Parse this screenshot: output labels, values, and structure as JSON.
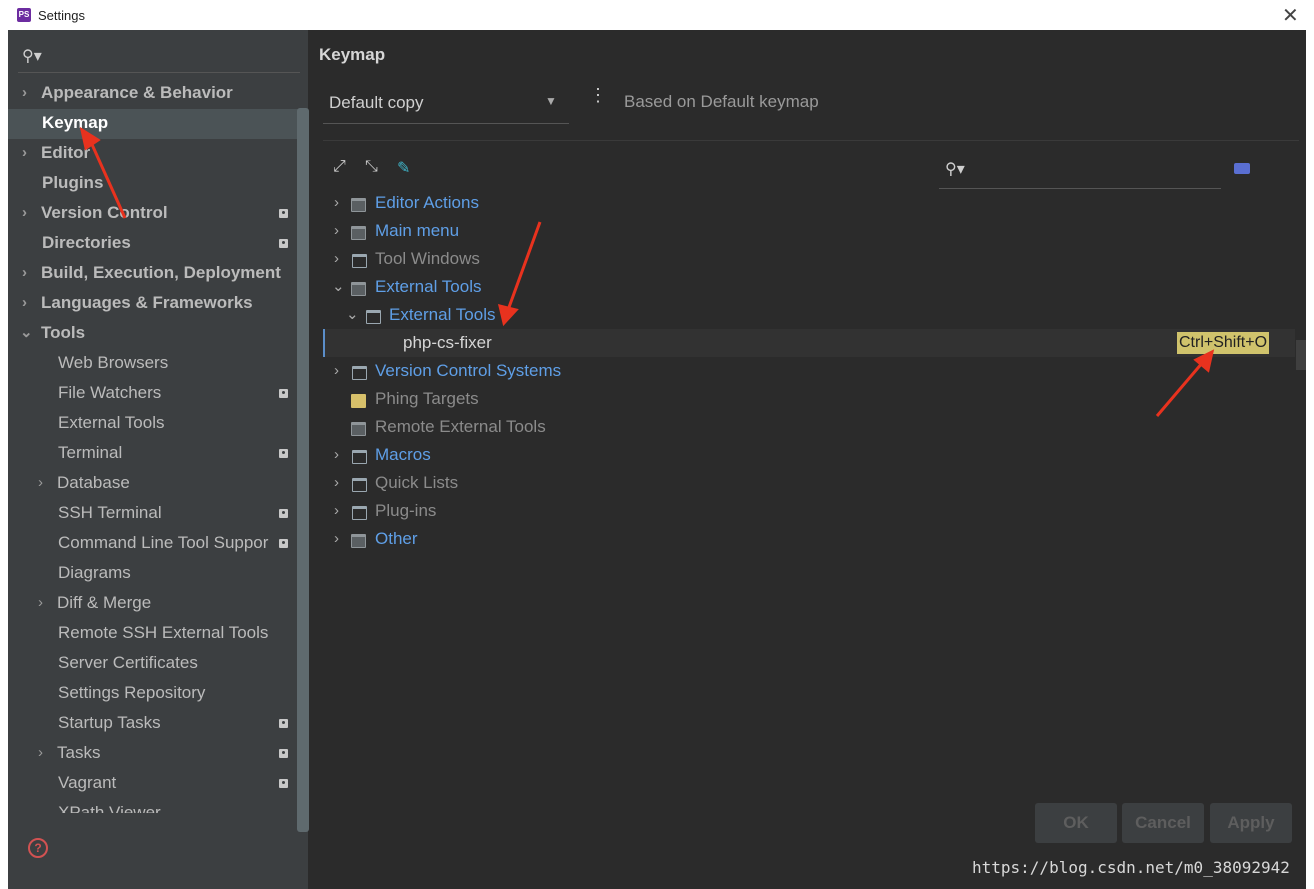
{
  "window": {
    "title": "Settings",
    "app_icon_text": "PS"
  },
  "sidebar": {
    "items": [
      {
        "label": "Appearance & Behavior",
        "bold": true
      },
      {
        "label": "Keymap",
        "bold": true,
        "selected": true
      },
      {
        "label": "Editor",
        "bold": true
      },
      {
        "label": "Plugins",
        "bold": true
      },
      {
        "label": "Version Control",
        "bold": true
      },
      {
        "label": "Directories",
        "bold": true
      },
      {
        "label": "Build, Execution, Deployment",
        "bold": true
      },
      {
        "label": "Languages & Frameworks",
        "bold": true
      },
      {
        "label": "Tools",
        "bold": true
      },
      {
        "label": "Web Browsers"
      },
      {
        "label": "File Watchers"
      },
      {
        "label": "External Tools"
      },
      {
        "label": "Terminal"
      },
      {
        "label": "Database"
      },
      {
        "label": "SSH Terminal"
      },
      {
        "label": "Command Line Tool Suppor"
      },
      {
        "label": "Diagrams"
      },
      {
        "label": "Diff & Merge"
      },
      {
        "label": "Remote SSH External Tools"
      },
      {
        "label": "Server Certificates"
      },
      {
        "label": "Settings Repository"
      },
      {
        "label": "Startup Tasks"
      },
      {
        "label": "Tasks"
      },
      {
        "label": "Vagrant"
      },
      {
        "label": "XPath Viewer"
      }
    ]
  },
  "main": {
    "title": "Keymap",
    "keymap_value": "Default copy",
    "based_on": "Based on Default keymap",
    "tree": [
      {
        "label": "Editor Actions"
      },
      {
        "label": "Main menu"
      },
      {
        "label": "Tool Windows"
      },
      {
        "label": "External Tools"
      },
      {
        "label": "External Tools"
      },
      {
        "label": "php-cs-fixer",
        "shortcut": "Ctrl+Shift+O"
      },
      {
        "label": "Version Control Systems"
      },
      {
        "label": "Phing Targets"
      },
      {
        "label": "Remote External Tools"
      },
      {
        "label": "Macros"
      },
      {
        "label": "Quick Lists"
      },
      {
        "label": "Plug-ins"
      },
      {
        "label": "Other"
      }
    ]
  },
  "buttons": {
    "ok": "OK",
    "cancel": "Cancel",
    "apply": "Apply"
  },
  "watermark": "https://blog.csdn.net/m0_38092942",
  "colors": {
    "link_blue": "#5f9fe7",
    "shortcut_bg": "#d0c36c",
    "arrow_red": "#e8321e"
  }
}
